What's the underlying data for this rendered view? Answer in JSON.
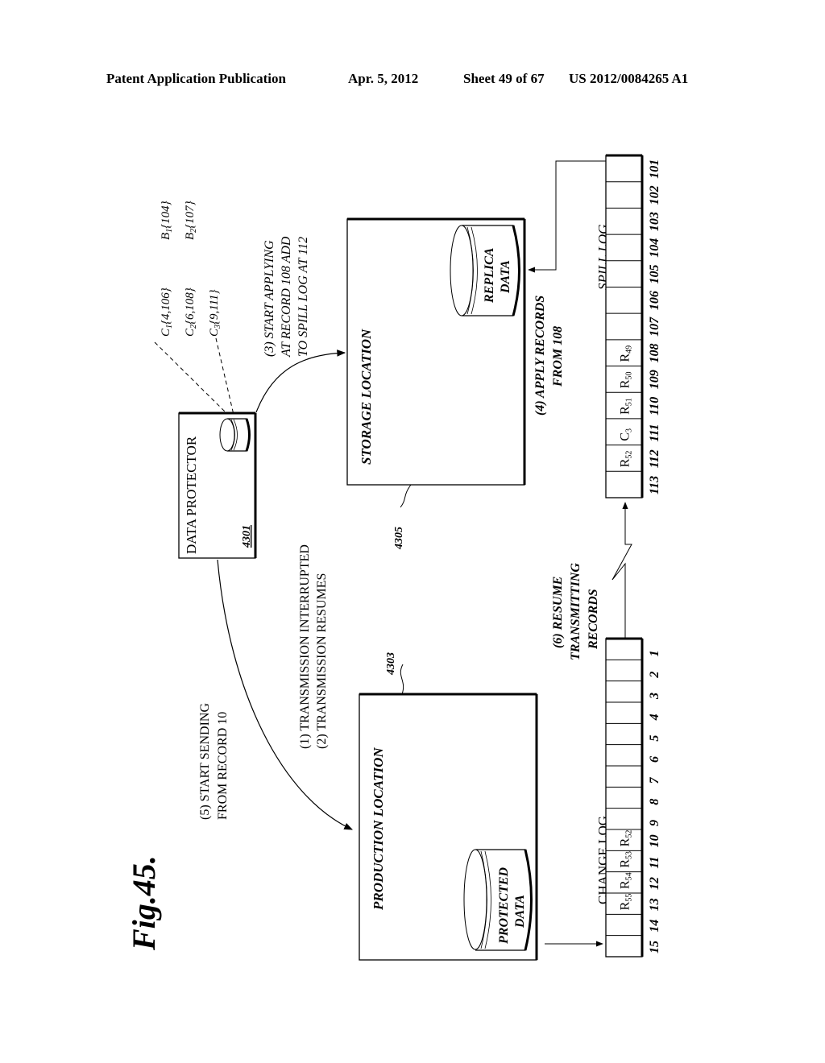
{
  "header": {
    "publication": "Patent Application Publication",
    "date": "Apr. 5, 2012",
    "sheet": "Sheet 49 of 67",
    "number": "US 2012/0084265 A1"
  },
  "figure": {
    "label": "Fig.45.",
    "orientation": "rotated 90° counter-clockwise",
    "boxes": {
      "data_protector": {
        "title": "DATA PROTECTOR",
        "ref": "4301"
      },
      "storage_location": {
        "title": "STORAGE LOCATION",
        "ref": "4305",
        "db_line1": "REPLICA",
        "db_line2": "DATA"
      },
      "production_location": {
        "title": "PRODUCTION LOCATION",
        "ref": "4303",
        "db_line1": "PROTECTED",
        "db_line2": "DATA"
      }
    },
    "checkpoints": [
      {
        "name": "C",
        "sub": "1",
        "value": "{4,106}"
      },
      {
        "name": "C",
        "sub": "2",
        "value": "{6,108}"
      },
      {
        "name": "C",
        "sub": "3",
        "value": "{9,111}"
      }
    ],
    "bookmarks": [
      {
        "name": "B",
        "sub": "1",
        "value": "{104}"
      },
      {
        "name": "B",
        "sub": "2",
        "value": "{107}"
      }
    ],
    "steps": {
      "step1": "(1) TRANSMISSION INTERRUPTED",
      "step2": "(2) TRANSMISSION RESUMES",
      "step3_line1": "(3) START APPLYING",
      "step3_line2": "AT RECORD 108 ADD",
      "step3_line3": "TO SPILL LOG AT 112",
      "step4_line1": "(4) APPLY RECORDS",
      "step4_line2": "FROM 108",
      "step5_line1": "(5) START SENDING",
      "step5_line2": "FROM RECORD 10",
      "step6_line1": "(6) RESUME",
      "step6_line2": "TRANSMITTING",
      "step6_line3": "RECORDS"
    },
    "spill_log": {
      "title": "SPILL LOG",
      "indices": [
        "113",
        "112",
        "111",
        "110",
        "109",
        "108",
        "107",
        "106",
        "105",
        "104",
        "103",
        "102",
        "101"
      ],
      "cells": [
        {
          "name": "",
          "sub": ""
        },
        {
          "name": "R",
          "sub": "52"
        },
        {
          "name": "C",
          "sub": "3"
        },
        {
          "name": "R",
          "sub": "51"
        },
        {
          "name": "R",
          "sub": "50"
        },
        {
          "name": "R",
          "sub": "49"
        },
        {
          "name": "",
          "sub": ""
        },
        {
          "name": "",
          "sub": ""
        },
        {
          "name": "",
          "sub": ""
        },
        {
          "name": "",
          "sub": ""
        },
        {
          "name": "",
          "sub": ""
        },
        {
          "name": "",
          "sub": ""
        },
        {
          "name": "",
          "sub": ""
        }
      ]
    },
    "change_log": {
      "title": "CHANGE LOG",
      "indices": [
        "15",
        "14",
        "13",
        "12",
        "11",
        "10",
        "9",
        "8",
        "7",
        "6",
        "5",
        "4",
        "3",
        "2",
        "1"
      ],
      "cells": [
        {
          "name": "",
          "sub": ""
        },
        {
          "name": "",
          "sub": ""
        },
        {
          "name": "R",
          "sub": "55"
        },
        {
          "name": "R",
          "sub": "54"
        },
        {
          "name": "R",
          "sub": "53"
        },
        {
          "name": "R",
          "sub": "52"
        },
        {
          "name": "",
          "sub": ""
        },
        {
          "name": "",
          "sub": ""
        },
        {
          "name": "",
          "sub": ""
        },
        {
          "name": "",
          "sub": ""
        },
        {
          "name": "",
          "sub": ""
        },
        {
          "name": "",
          "sub": ""
        },
        {
          "name": "",
          "sub": ""
        },
        {
          "name": "",
          "sub": ""
        },
        {
          "name": "",
          "sub": ""
        }
      ]
    }
  }
}
